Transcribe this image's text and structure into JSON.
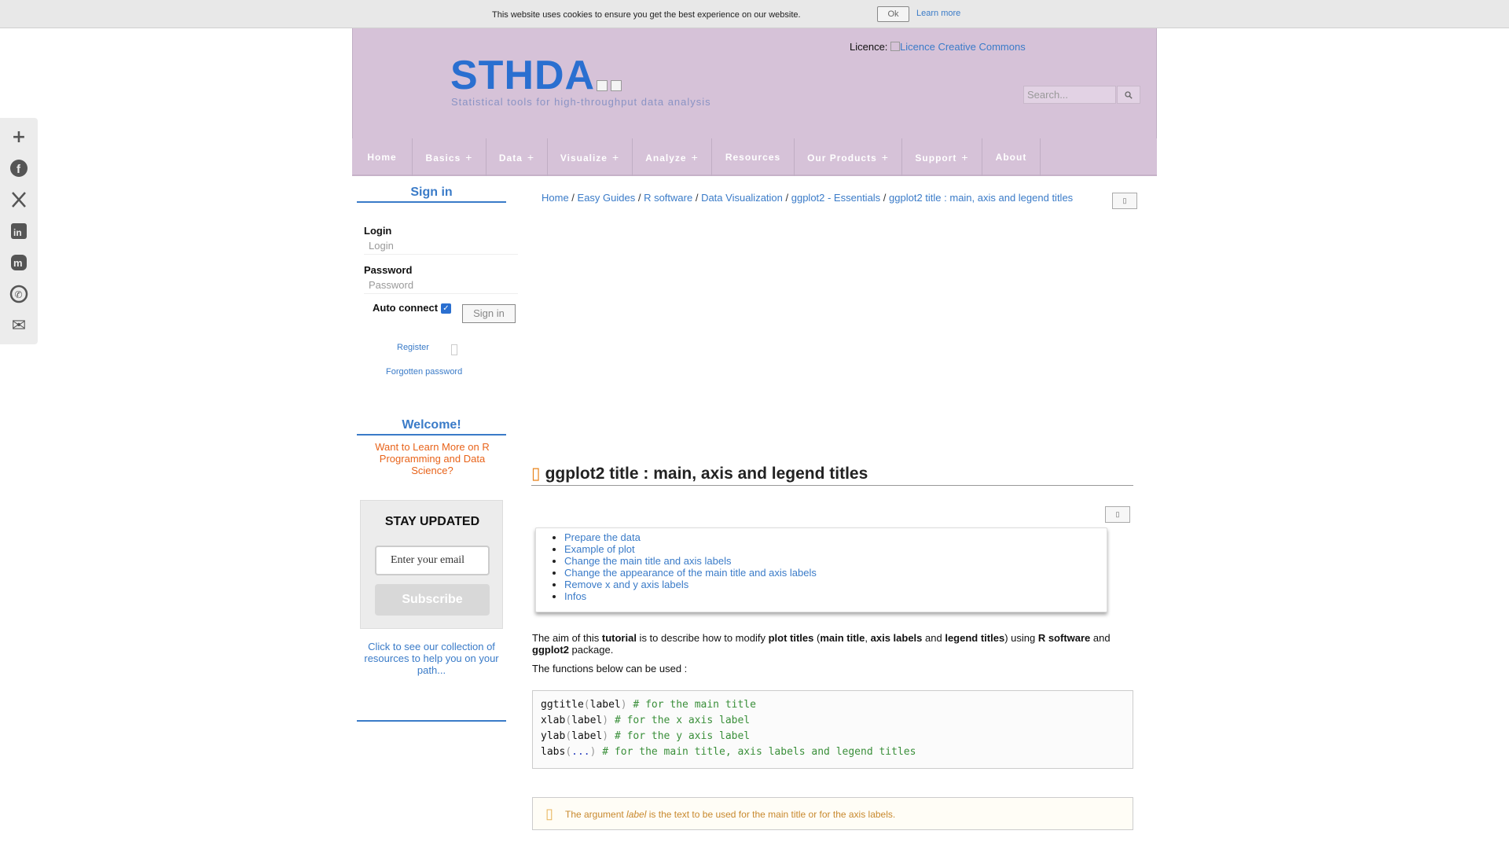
{
  "cookie": {
    "text": "This website uses cookies to ensure you get the best experience on our website.",
    "ok_label": "Ok",
    "learn_more": "Learn more"
  },
  "share": {
    "items": [
      "share",
      "facebook",
      "x",
      "linkedin",
      "mastodon",
      "whatsapp",
      "email"
    ],
    "plus_glyph": "+",
    "facebook_glyph": "f",
    "x_glyph": "X",
    "linkedin_glyph": "in",
    "mastodon_glyph": "m",
    "whatsapp_glyph": "✆",
    "email_glyph": "✉"
  },
  "header": {
    "logo": "STHDA",
    "tagline": "Statistical tools for high-throughput data analysis",
    "licence_label": "Licence:",
    "licence_link": "Licence Creative Commons",
    "search_placeholder": "Search...",
    "search_icon": "🔍"
  },
  "nav": {
    "items": [
      {
        "label": "Home",
        "has_plus": false
      },
      {
        "label": "Basics",
        "has_plus": true
      },
      {
        "label": "Data",
        "has_plus": true
      },
      {
        "label": "Visualize",
        "has_plus": true
      },
      {
        "label": "Analyze",
        "has_plus": true
      },
      {
        "label": "Resources",
        "has_plus": false
      },
      {
        "label": "Our Products",
        "has_plus": true
      },
      {
        "label": "Support",
        "has_plus": true
      },
      {
        "label": "About",
        "has_plus": false
      }
    ],
    "plus": "+"
  },
  "sidebar": {
    "signin_heading": "Sign in",
    "login_label": "Login",
    "login_placeholder": "Login",
    "password_label": "Password",
    "password_placeholder": "Password",
    "auto_connect": "Auto connect",
    "auto_connect_checked": true,
    "signin_button": "Sign in",
    "register": "Register",
    "forgotten": "Forgotten password",
    "welcome_heading": "Welcome!",
    "welcome_text": "Want to Learn More on R Programming and Data Science?",
    "stay_title": "STAY UPDATED",
    "email_placeholder": "Enter your email",
    "subscribe": "Subscribe",
    "collection_text": "Click to see our collection of resources to help you on your path..."
  },
  "breadcrumb": [
    "Home",
    "Easy Guides",
    "R software",
    "Data Visualization",
    "ggplot2 - Essentials",
    "ggplot2 title : main, axis and legend titles"
  ],
  "breadcrumb_sep": " / ",
  "article": {
    "title": "ggplot2 title : main, axis and legend titles",
    "toc": [
      "Prepare the data",
      "Example of plot",
      "Change the main title and axis labels",
      "Change the appearance of the main title and axis labels",
      "Remove x and y axis labels",
      "Infos"
    ],
    "intro": {
      "p1": "The aim of this ",
      "b1": "tutorial",
      "p2": " is to describe how to modify ",
      "b2": "plot titles",
      "p3": " (",
      "b3": "main title",
      "p4": ", ",
      "b4": "axis labels",
      "p5": " and ",
      "b5": "legend titles",
      "p6": ") using ",
      "b6": "R software",
      "p7": " and ",
      "b7": "ggplot2",
      "p8": " package."
    },
    "functions_text": "The functions below can be used :",
    "code": [
      {
        "fn": "ggtitle",
        "arg": "label",
        "comment": "# for the main title"
      },
      {
        "fn": "xlab",
        "arg": "label",
        "comment": "# for the x axis label"
      },
      {
        "fn": "ylab",
        "arg": "label",
        "comment": "# for the y axis label"
      },
      {
        "fn": "labs",
        "arg": "...",
        "comment": "# for the main title, axis labels and legend titles"
      }
    ],
    "note": {
      "pre": "The argument ",
      "em": "label",
      "post": " is the text to be used for the main title or for the axis labels."
    }
  },
  "colors": {
    "header_bg": "#d6c2d8",
    "link": "#3a7bc8",
    "logo": "#2a6fd0",
    "accent_orange": "#e8631a"
  }
}
